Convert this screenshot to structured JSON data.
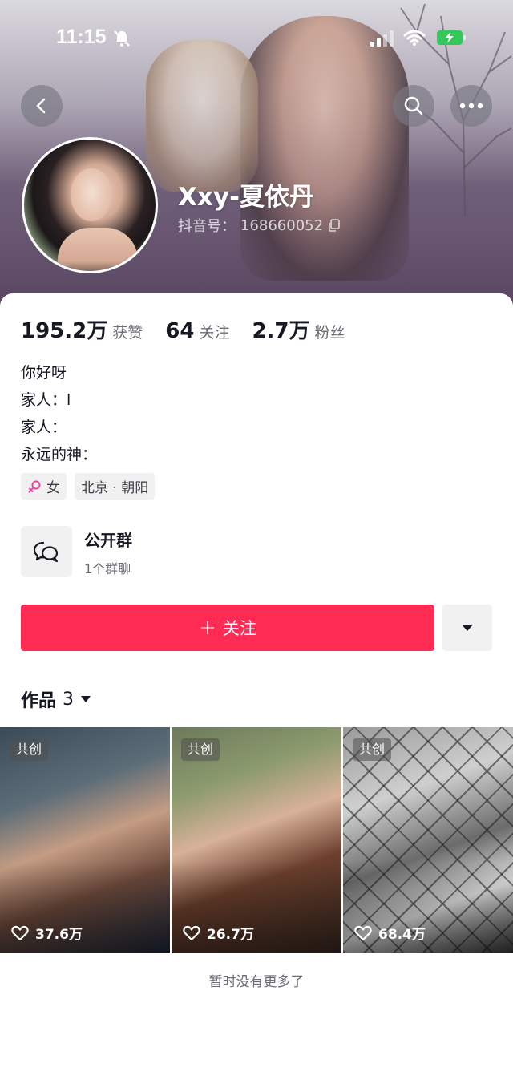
{
  "status_bar": {
    "time": "11:15"
  },
  "profile": {
    "username": "Xxy-夏依丹",
    "douyin_id_label": "抖音号：",
    "douyin_id": "168660052"
  },
  "stats": [
    {
      "value": "195.2万",
      "label": "获赞"
    },
    {
      "value": "64",
      "label": "关注"
    },
    {
      "value": "2.7万",
      "label": "粉丝"
    }
  ],
  "bio": [
    "你好呀",
    "家人：l",
    "家人：",
    "永远的神："
  ],
  "tags": {
    "gender": "女",
    "location": "北京 · 朝阳"
  },
  "group": {
    "title": "公开群",
    "subtitle": "1个群聊"
  },
  "follow_button": {
    "label": "关注"
  },
  "works_tab": {
    "label": "作品",
    "count": "3"
  },
  "videos": [
    {
      "badge": "共创",
      "likes": "37.6万"
    },
    {
      "badge": "共创",
      "likes": "26.7万"
    },
    {
      "badge": "共创",
      "likes": "68.4万"
    }
  ],
  "footer": {
    "no_more": "暂时没有更多了"
  },
  "colors": {
    "accent": "#fe2c55",
    "text": "#161823",
    "secondary": "#6b6d75",
    "chip_bg": "#f1f1f2"
  }
}
